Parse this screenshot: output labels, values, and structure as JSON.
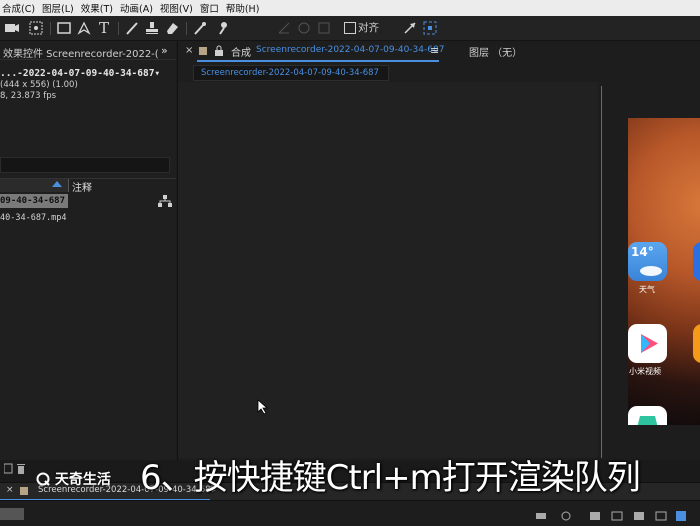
{
  "menu": [
    "合成(C)",
    "图层(L)",
    "效果(T)",
    "动画(A)",
    "视图(V)",
    "窗口",
    "帮助(H)"
  ],
  "toolbar": {
    "snap_label": "对齐"
  },
  "effects_panel": {
    "title": "效果控件 Screenrecorder-2022-(",
    "comp_line": "...-2022-04-07-09-40-34-687▾",
    "size_line": "(444 x 556) (1.00)",
    "fps_line": "8, 23.873 fps"
  },
  "project_panel": {
    "comment_header": "注释",
    "selected_item": "09-40-34-687",
    "file_item": "40-34-687.mp4"
  },
  "comp_panel": {
    "title_prefix": "合成",
    "title": "Screenrecorder-2022-04-07-09-40-34-687",
    "subtab": "Screenrecorder-2022-04-07-09-40-34-687"
  },
  "layer_panel": {
    "title": "图层 （无）"
  },
  "phone": {
    "weather_temp": "14°",
    "weather_label": "天气",
    "video_label": "小米视频"
  },
  "timeline": {
    "tab_label": "Screenrecorder-2022-04-07-09-40-34-687"
  },
  "watermark": "天奇生活",
  "caption": "6、按快捷键Ctrl+m打开渲染队列"
}
